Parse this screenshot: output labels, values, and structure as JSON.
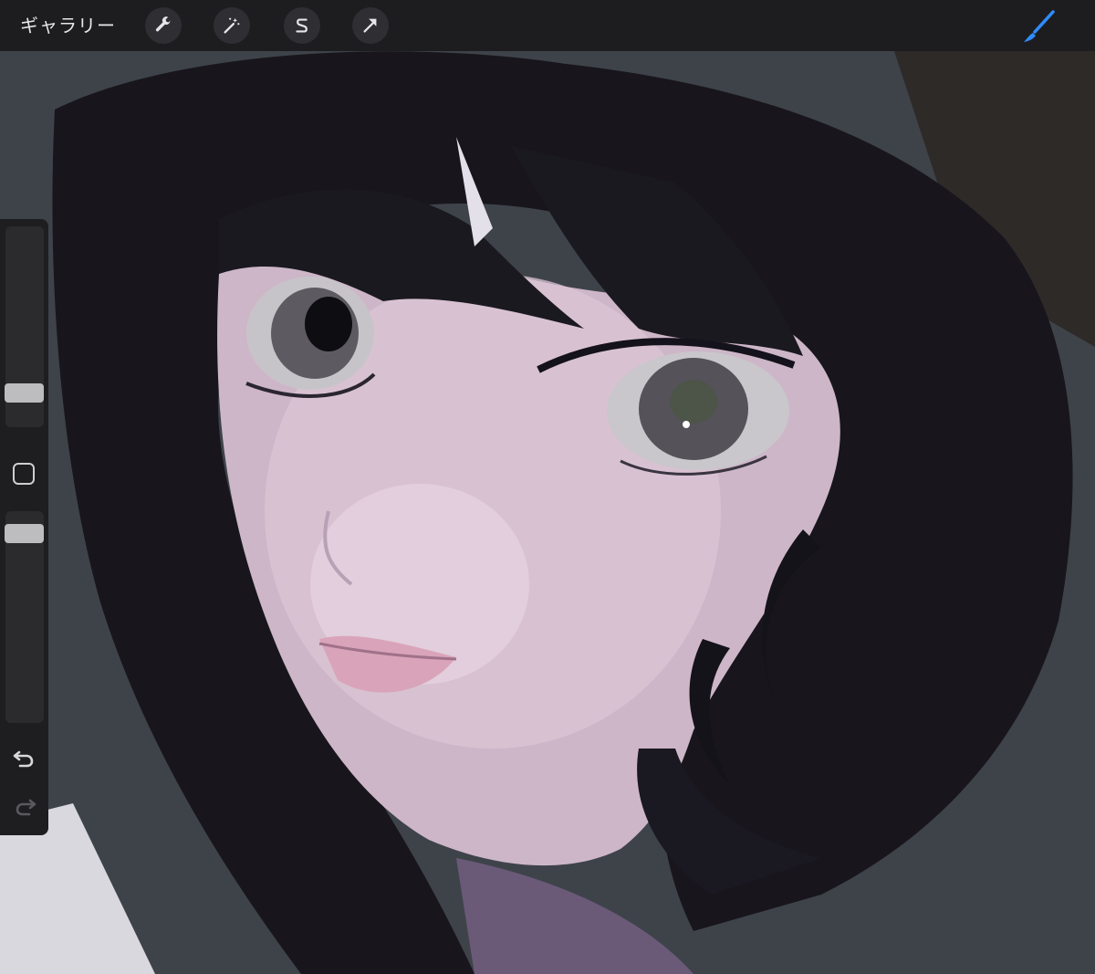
{
  "toolbar": {
    "gallery_label": "ギャラリー",
    "tools": [
      {
        "name": "actions",
        "icon": "wrench-icon"
      },
      {
        "name": "adjustments",
        "icon": "magic-wand-icon"
      },
      {
        "name": "selection",
        "icon": "selection-s-icon"
      },
      {
        "name": "transform",
        "icon": "arrow-cursor-icon"
      }
    ],
    "active_tool": {
      "name": "brush",
      "icon": "brush-icon",
      "color": "#2f8cff"
    }
  },
  "sidebar": {
    "brush_size_level": 0.2,
    "opacity_level": 0.85,
    "modify_icon": "square-modify-icon",
    "undo_icon": "undo-icon",
    "redo_icon": "redo-icon"
  },
  "colors": {
    "toolbar_bg": "#1d1d1f",
    "accent": "#2f8cff",
    "hair": "#15131a",
    "skin": "#d9c3d3"
  }
}
